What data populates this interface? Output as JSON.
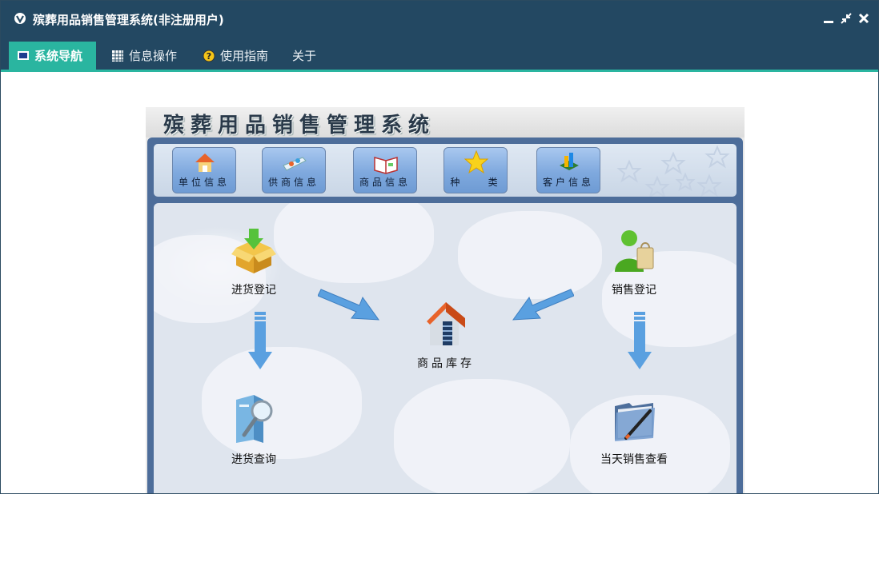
{
  "window": {
    "title": "殡葬用品销售管理系统(非注册用户)"
  },
  "menu": {
    "items": [
      {
        "label": "系统导航",
        "icon": "monitor-icon",
        "active": true
      },
      {
        "label": "信息操作",
        "icon": "grid-icon",
        "active": false
      },
      {
        "label": "使用指南",
        "icon": "help-icon",
        "active": false
      },
      {
        "label": "关于",
        "icon": "",
        "active": false
      }
    ]
  },
  "panel": {
    "title": "殡葬用品销售管理系统",
    "toolbar": [
      {
        "label": "单位信息",
        "icon": "house-icon"
      },
      {
        "label": "供商信息",
        "icon": "supplier-icon"
      },
      {
        "label": "商品信息",
        "icon": "book-icon"
      },
      {
        "label": "种    类",
        "icon": "star-icon"
      },
      {
        "label": "客户信息",
        "icon": "chart-icon"
      }
    ],
    "nodes": {
      "purchase_register": "进货登记",
      "sales_register": "销售登记",
      "inventory": "商品库存",
      "purchase_query": "进货查询",
      "daily_sales": "当天销售查看"
    }
  },
  "colors": {
    "titlebar": "#234862",
    "accent": "#2ab5a0"
  }
}
